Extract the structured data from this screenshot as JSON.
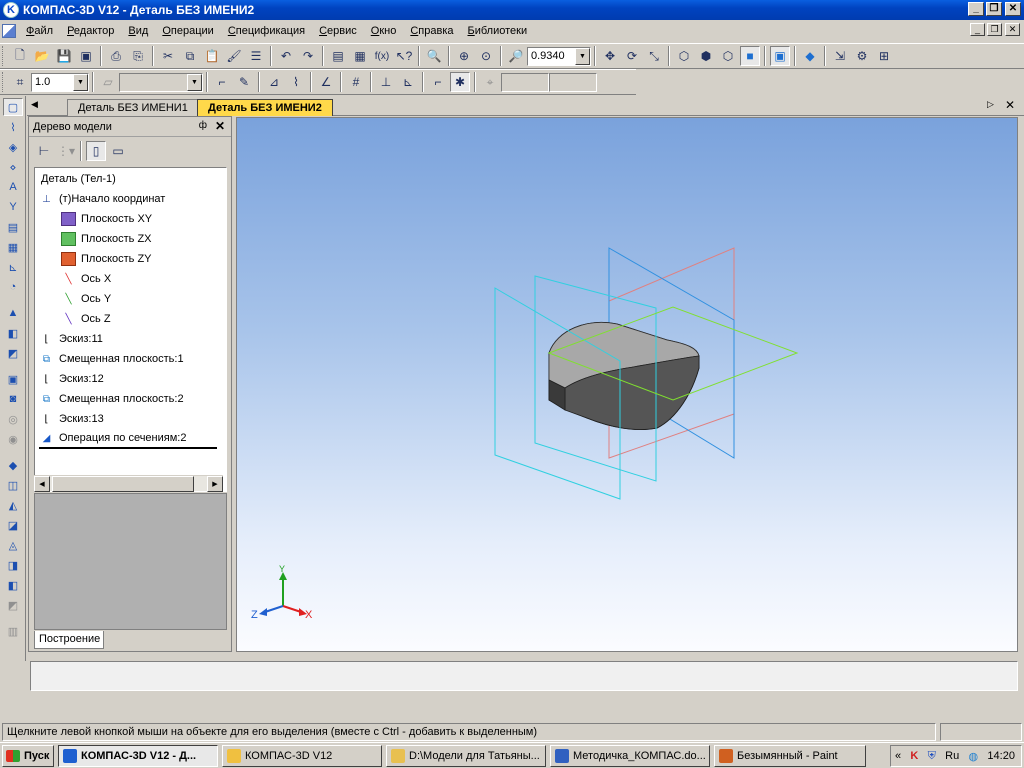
{
  "window": {
    "title": "КОМПАС-3D V12 - Деталь БЕЗ ИМЕНИ2",
    "app_icon": "K"
  },
  "menu": [
    "Файл",
    "Редактор",
    "Вид",
    "Операции",
    "Спецификация",
    "Сервис",
    "Окно",
    "Справка",
    "Библиотеки"
  ],
  "toolbar": {
    "zoom_value": "0.9340",
    "line_step_value": "1.0"
  },
  "tabs": [
    {
      "label": "Деталь БЕЗ ИМЕНИ1",
      "active": false
    },
    {
      "label": "Деталь БЕЗ ИМЕНИ2",
      "active": true
    }
  ],
  "tree_panel": {
    "title": "Дерево модели",
    "bottom_tab": "Построение",
    "items": [
      {
        "label": "Деталь (Тел-1)",
        "icon": "part-icon"
      },
      {
        "label": "(т)Начало координат",
        "icon": "origin-icon"
      },
      {
        "label": "Плоскость XY",
        "icon": "plane-xy-icon"
      },
      {
        "label": "Плоскость ZX",
        "icon": "plane-zx-icon"
      },
      {
        "label": "Плоскость ZY",
        "icon": "plane-zy-icon"
      },
      {
        "label": "Ось X",
        "icon": "axis-x-icon"
      },
      {
        "label": "Ось Y",
        "icon": "axis-y-icon"
      },
      {
        "label": "Ось Z",
        "icon": "axis-z-icon"
      },
      {
        "label": "Эскиз:11",
        "icon": "sketch-icon"
      },
      {
        "label": "Смещенная плоскость:1",
        "icon": "offset-plane-icon"
      },
      {
        "label": "Эскиз:12",
        "icon": "sketch-icon"
      },
      {
        "label": "Смещенная плоскость:2",
        "icon": "offset-plane-icon"
      },
      {
        "label": "Эскиз:13",
        "icon": "sketch-icon"
      },
      {
        "label": "Операция по сечениям:2",
        "icon": "loft-icon"
      }
    ]
  },
  "axes": {
    "x": "X",
    "y": "Y",
    "z": "Z"
  },
  "status": {
    "text": "Щелкните левой кнопкой мыши на объекте для его выделения (вместе с Ctrl - добавить к выделенным)"
  },
  "taskbar": {
    "start": "Пуск",
    "tasks": [
      {
        "label": "КОМПАС-3D V12 - Д...",
        "active": true
      },
      {
        "label": "КОМПАС-3D V12",
        "active": false
      },
      {
        "label": "D:\\Модели для Татьяны...",
        "active": false
      },
      {
        "label": "Методичка_КОМПАС.do...",
        "active": false
      },
      {
        "label": "Безымянный - Paint",
        "active": false
      }
    ],
    "lang": "Ru",
    "clock": "14:20"
  }
}
